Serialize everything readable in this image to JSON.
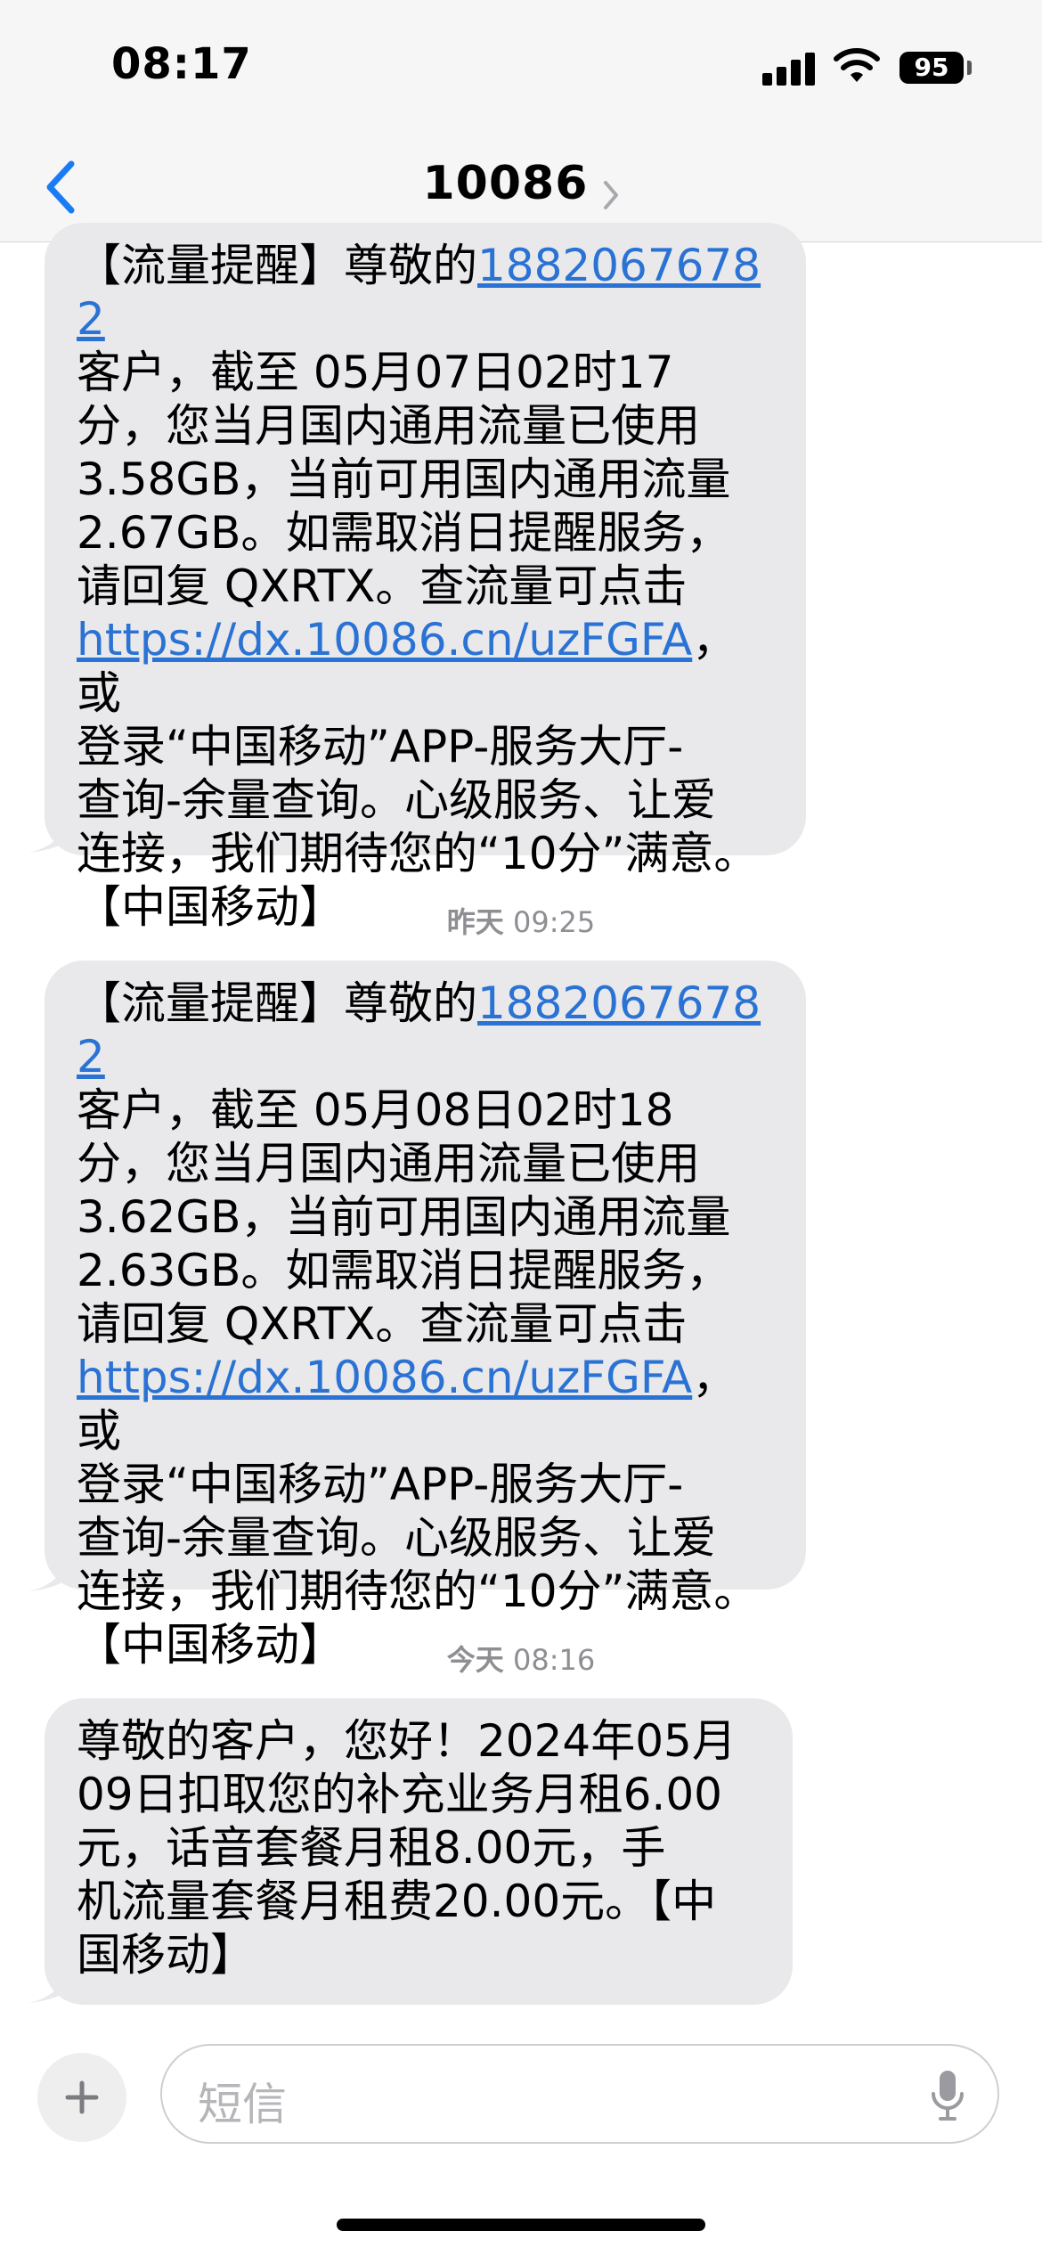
{
  "status_bar": {
    "time": "08:17",
    "battery": "95",
    "icons": [
      "signal-icon",
      "wifi-icon",
      "battery-icon"
    ]
  },
  "nav": {
    "title": "10086",
    "icons": [
      "back-chevron-icon",
      "forward-chevron-icon"
    ]
  },
  "messages": [
    {
      "parts": [
        "【流量提醒】尊敬的",
        "18820676782",
        "\n客户，截至 05月07日02时17\n分，您当月国内通用流量已使用\n3.58GB，当前可用国内通用流量\n2.67GB。如需取消日提醒服务，\n请回复 QXRTX。查流量可点击\n",
        "https://dx.10086.cn/uzFGFA",
        "，或\n登录“中国移动”APP-服务大厅-\n查询-余量查询。心级服务、让爱\n连接，我们期待您的“10分”满意。\n【中国移动】"
      ]
    },
    {
      "parts": [
        "【流量提醒】尊敬的",
        "18820676782",
        "\n客户，截至 05月08日02时18\n分，您当月国内通用流量已使用\n3.62GB，当前可用国内通用流量\n2.63GB。如需取消日提醒服务，\n请回复 QXRTX。查流量可点击\n",
        "https://dx.10086.cn/uzFGFA",
        "，或\n登录“中国移动”APP-服务大厅-\n查询-余量查询。心级服务、让爱\n连接，我们期待您的“10分”满意。\n【中国移动】"
      ]
    },
    {
      "text": "尊敬的客户，您好！2024年05月\n09日扣取您的补充业务月租6.00\n元，话音套餐月租8.00元，手\n机流量套餐月租费20.00元。【中\n国移动】"
    }
  ],
  "timestamps": [
    {
      "day": "昨天",
      "time": "09:25"
    },
    {
      "day": "今天",
      "time": "08:16"
    }
  ],
  "composer": {
    "placeholder": "短信",
    "icons": [
      "plus-icon",
      "microphone-icon"
    ]
  },
  "colors": {
    "link": "#2a72d4",
    "bubble": "#e9e9eb",
    "accent": "#1a7cf5"
  }
}
